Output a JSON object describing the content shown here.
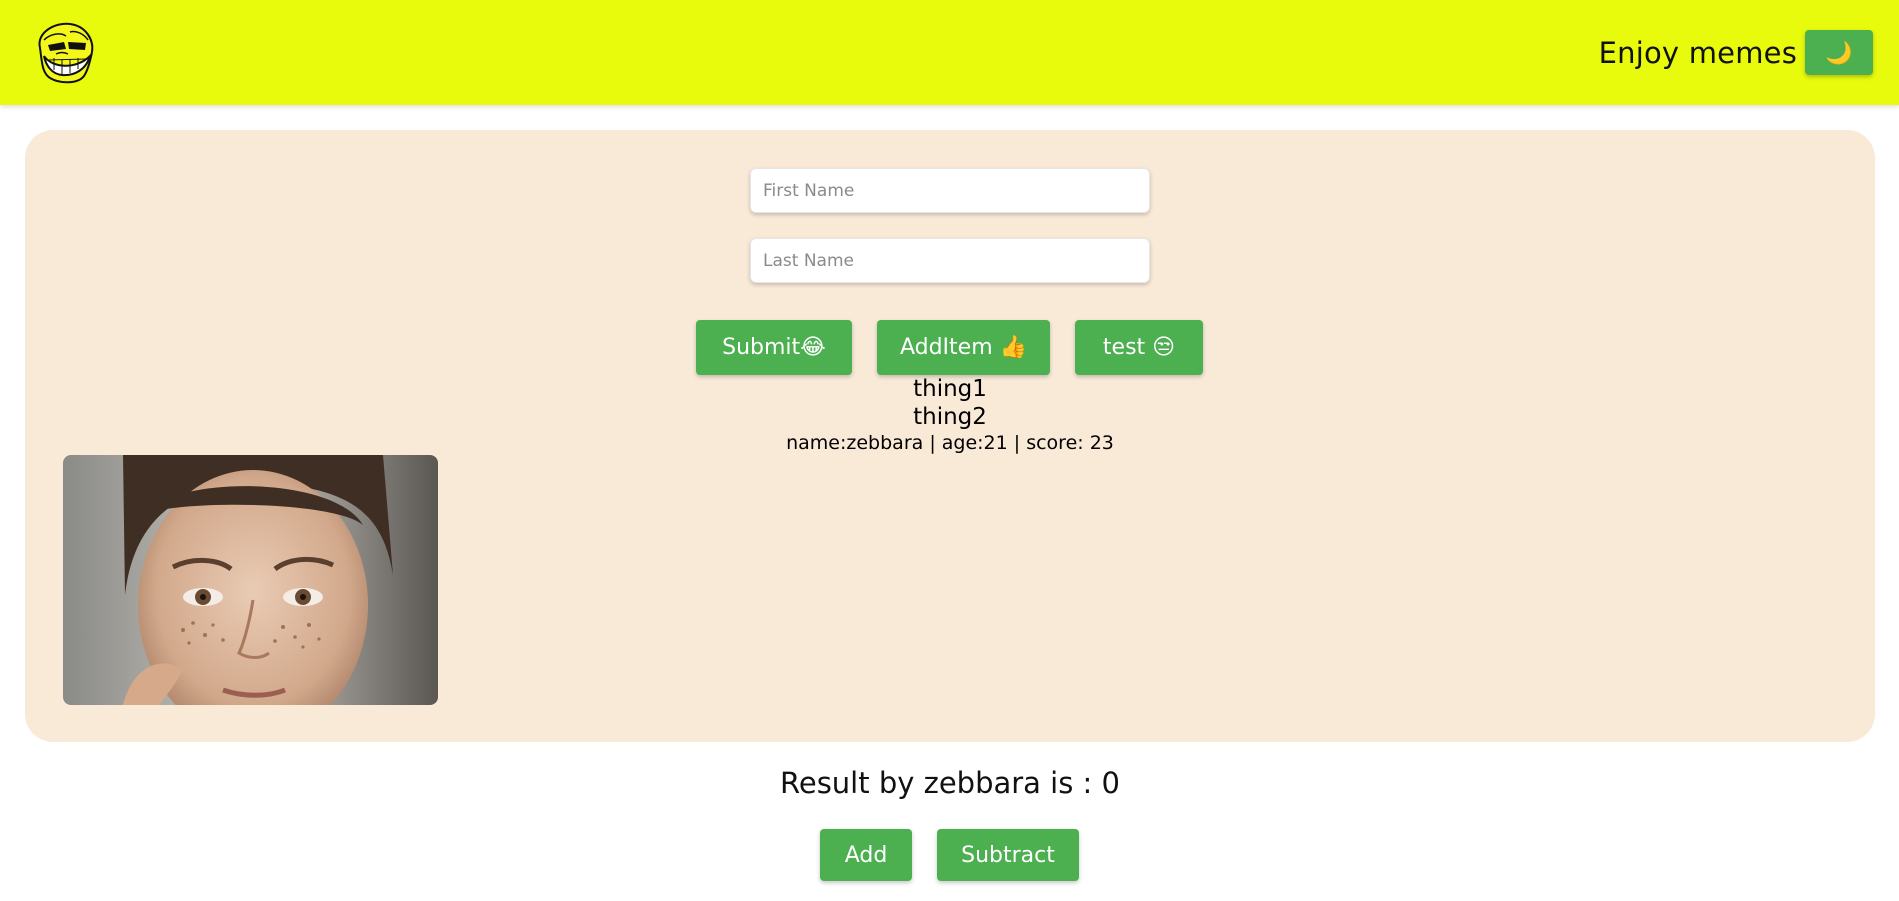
{
  "header": {
    "title": "Enjoy memes",
    "theme_toggle_label": "🌙",
    "logo_icon": "troll-face-icon",
    "background": "#e8fb0d"
  },
  "form": {
    "first_name_placeholder": "First Name",
    "first_name_value": "",
    "last_name_placeholder": "Last Name",
    "last_name_value": "",
    "buttons": {
      "submit_label": "Submit😂",
      "additem_label": "AddItem 👍",
      "test_label": "test 😒"
    }
  },
  "items": [
    "thing1",
    "thing2"
  ],
  "person_line": "name:zebbara | age:21 | score: 23",
  "counter": {
    "result_text": "Result by zebbara is : 0",
    "add_label": "Add",
    "subtract_label": "Subtract"
  },
  "colors": {
    "accent": "#4caf50",
    "panel": "#f9ead8",
    "header": "#e8fb0d"
  }
}
